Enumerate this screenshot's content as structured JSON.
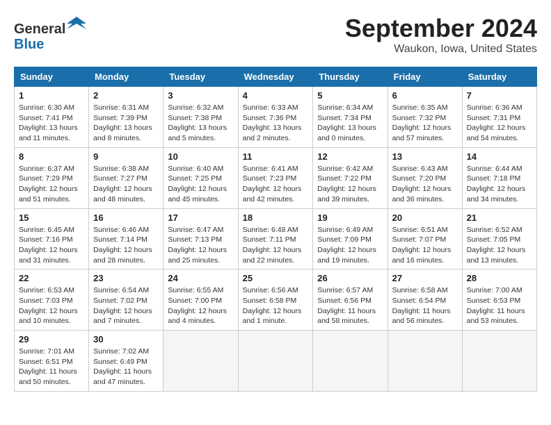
{
  "logo": {
    "general": "General",
    "blue": "Blue"
  },
  "title": "September 2024",
  "location": "Waukon, Iowa, United States",
  "days_of_week": [
    "Sunday",
    "Monday",
    "Tuesday",
    "Wednesday",
    "Thursday",
    "Friday",
    "Saturday"
  ],
  "weeks": [
    [
      {
        "day": "1",
        "sunrise": "6:30 AM",
        "sunset": "7:41 PM",
        "daylight": "13 hours and 11 minutes."
      },
      {
        "day": "2",
        "sunrise": "6:31 AM",
        "sunset": "7:39 PM",
        "daylight": "13 hours and 8 minutes."
      },
      {
        "day": "3",
        "sunrise": "6:32 AM",
        "sunset": "7:38 PM",
        "daylight": "13 hours and 5 minutes."
      },
      {
        "day": "4",
        "sunrise": "6:33 AM",
        "sunset": "7:36 PM",
        "daylight": "13 hours and 2 minutes."
      },
      {
        "day": "5",
        "sunrise": "6:34 AM",
        "sunset": "7:34 PM",
        "daylight": "13 hours and 0 minutes."
      },
      {
        "day": "6",
        "sunrise": "6:35 AM",
        "sunset": "7:32 PM",
        "daylight": "12 hours and 57 minutes."
      },
      {
        "day": "7",
        "sunrise": "6:36 AM",
        "sunset": "7:31 PM",
        "daylight": "12 hours and 54 minutes."
      }
    ],
    [
      {
        "day": "8",
        "sunrise": "6:37 AM",
        "sunset": "7:29 PM",
        "daylight": "12 hours and 51 minutes."
      },
      {
        "day": "9",
        "sunrise": "6:38 AM",
        "sunset": "7:27 PM",
        "daylight": "12 hours and 48 minutes."
      },
      {
        "day": "10",
        "sunrise": "6:40 AM",
        "sunset": "7:25 PM",
        "daylight": "12 hours and 45 minutes."
      },
      {
        "day": "11",
        "sunrise": "6:41 AM",
        "sunset": "7:23 PM",
        "daylight": "12 hours and 42 minutes."
      },
      {
        "day": "12",
        "sunrise": "6:42 AM",
        "sunset": "7:22 PM",
        "daylight": "12 hours and 39 minutes."
      },
      {
        "day": "13",
        "sunrise": "6:43 AM",
        "sunset": "7:20 PM",
        "daylight": "12 hours and 36 minutes."
      },
      {
        "day": "14",
        "sunrise": "6:44 AM",
        "sunset": "7:18 PM",
        "daylight": "12 hours and 34 minutes."
      }
    ],
    [
      {
        "day": "15",
        "sunrise": "6:45 AM",
        "sunset": "7:16 PM",
        "daylight": "12 hours and 31 minutes."
      },
      {
        "day": "16",
        "sunrise": "6:46 AM",
        "sunset": "7:14 PM",
        "daylight": "12 hours and 28 minutes."
      },
      {
        "day": "17",
        "sunrise": "6:47 AM",
        "sunset": "7:13 PM",
        "daylight": "12 hours and 25 minutes."
      },
      {
        "day": "18",
        "sunrise": "6:48 AM",
        "sunset": "7:11 PM",
        "daylight": "12 hours and 22 minutes."
      },
      {
        "day": "19",
        "sunrise": "6:49 AM",
        "sunset": "7:09 PM",
        "daylight": "12 hours and 19 minutes."
      },
      {
        "day": "20",
        "sunrise": "6:51 AM",
        "sunset": "7:07 PM",
        "daylight": "12 hours and 16 minutes."
      },
      {
        "day": "21",
        "sunrise": "6:52 AM",
        "sunset": "7:05 PM",
        "daylight": "12 hours and 13 minutes."
      }
    ],
    [
      {
        "day": "22",
        "sunrise": "6:53 AM",
        "sunset": "7:03 PM",
        "daylight": "12 hours and 10 minutes."
      },
      {
        "day": "23",
        "sunrise": "6:54 AM",
        "sunset": "7:02 PM",
        "daylight": "12 hours and 7 minutes."
      },
      {
        "day": "24",
        "sunrise": "6:55 AM",
        "sunset": "7:00 PM",
        "daylight": "12 hours and 4 minutes."
      },
      {
        "day": "25",
        "sunrise": "6:56 AM",
        "sunset": "6:58 PM",
        "daylight": "12 hours and 1 minute."
      },
      {
        "day": "26",
        "sunrise": "6:57 AM",
        "sunset": "6:56 PM",
        "daylight": "11 hours and 58 minutes."
      },
      {
        "day": "27",
        "sunrise": "6:58 AM",
        "sunset": "6:54 PM",
        "daylight": "11 hours and 56 minutes."
      },
      {
        "day": "28",
        "sunrise": "7:00 AM",
        "sunset": "6:53 PM",
        "daylight": "11 hours and 53 minutes."
      }
    ],
    [
      {
        "day": "29",
        "sunrise": "7:01 AM",
        "sunset": "6:51 PM",
        "daylight": "11 hours and 50 minutes."
      },
      {
        "day": "30",
        "sunrise": "7:02 AM",
        "sunset": "6:49 PM",
        "daylight": "11 hours and 47 minutes."
      },
      null,
      null,
      null,
      null,
      null
    ]
  ]
}
